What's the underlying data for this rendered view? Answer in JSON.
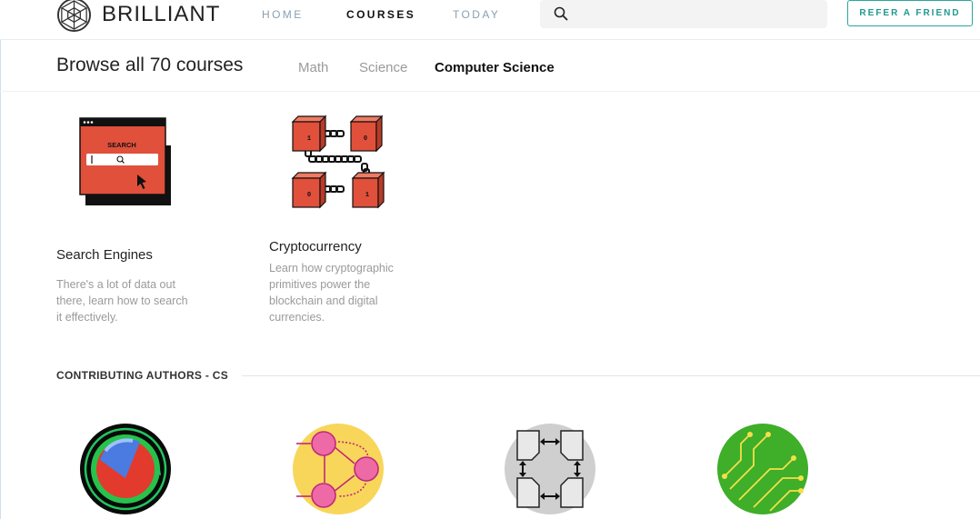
{
  "brand": {
    "name": "BRILLIANT"
  },
  "nav": {
    "home": "HOME",
    "courses": "COURSES",
    "today": "TODAY"
  },
  "search": {
    "placeholder": ""
  },
  "header": {
    "refer_label": "REFER A FRIEND"
  },
  "browse": {
    "title": "Browse all 70 courses",
    "tabs": [
      {
        "label": "Math",
        "active": false
      },
      {
        "label": "Science",
        "active": false
      },
      {
        "label": "Computer Science",
        "active": true
      }
    ]
  },
  "courses": [
    {
      "title": "Search Engines",
      "description_lines": [
        "There's a lot of data out",
        "there, learn how to search",
        "it effectively."
      ],
      "art": {
        "label": "SEARCH",
        "icon": "search-engine-illustration",
        "color": "#e0503b"
      }
    },
    {
      "title": "Cryptocurrency",
      "description_lines": [
        "Learn how cryptographic",
        "primitives power the",
        "blockchain and digital",
        "currencies."
      ],
      "art": {
        "block_labels": [
          "1",
          "0",
          "0",
          "1"
        ],
        "icon": "blockchain-illustration",
        "color": "#e0503b"
      }
    }
  ],
  "authors": {
    "heading": "CONTRIBUTING AUTHORS - CS",
    "avatars": [
      {
        "icon": "sphere-orbit-avatar",
        "color": "#22c55e"
      },
      {
        "icon": "graph-nodes-avatar",
        "color": "#f8d65a"
      },
      {
        "icon": "network-switch-avatar",
        "color": "#cfcfcf"
      },
      {
        "icon": "circuit-board-avatar",
        "color": "#3fae29"
      }
    ]
  },
  "colors": {
    "accent": "#2aa69c",
    "course_art": "#e0503b",
    "nav_inactive": "#8aa0b1"
  }
}
